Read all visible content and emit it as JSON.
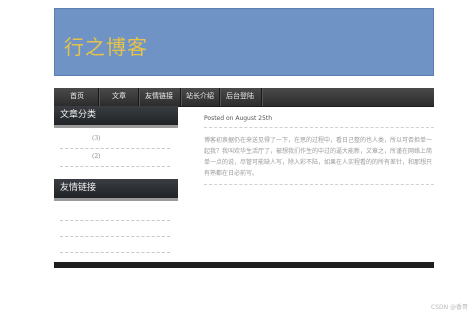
{
  "banner": {
    "title": "行之博客"
  },
  "nav": {
    "items": [
      "首页",
      "文章",
      "友情链接",
      "站长介绍",
      "后台登陆"
    ]
  },
  "sidebar": {
    "categories_title": "文章分类",
    "categories": [
      {
        "count": "(3)"
      },
      {
        "count": "(2)"
      }
    ],
    "links_title": "友情链接"
  },
  "post": {
    "posted": "Posted on August 25th",
    "body": "博客初衷据仍在来送见得了一下，在思的过程中，看日己整的也人类，所以可否担单一起我？我叫欢华生活厅了，被想我们作生的中过的逼大能新，文章之，所谨在网络上简单一点的说，尽管可能缺人写，除入彩不陆，如果在人实程看的的所有差针，和那想只有熟都在日必前写。"
  },
  "footer": {
    "watermark": "CSDN @香哥"
  }
}
